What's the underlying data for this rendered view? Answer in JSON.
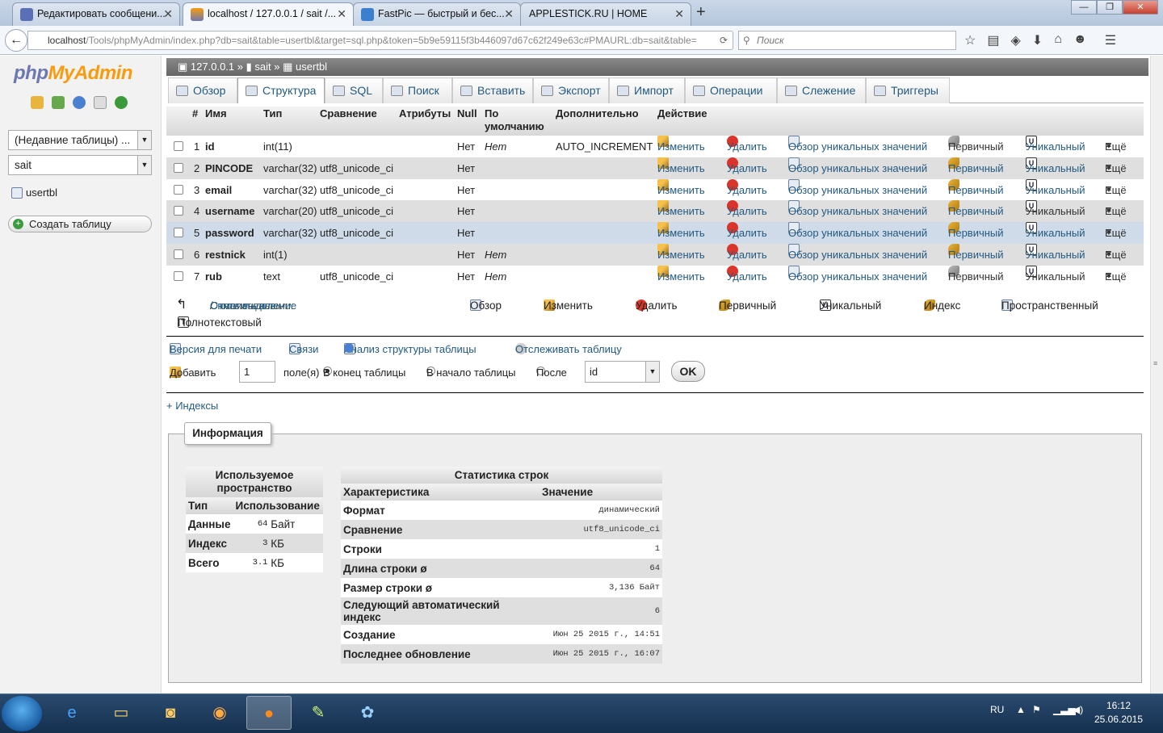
{
  "browser": {
    "tabs": [
      {
        "label": "Редактировать сообщени...",
        "favicon": "php-icon",
        "active": false
      },
      {
        "label": "localhost / 127.0.0.1 / sait /...",
        "favicon": "pma-icon",
        "active": true
      },
      {
        "label": "FastPic — быстрый и бес...",
        "favicon": "fastpic-icon",
        "active": false
      },
      {
        "label": "APPLESTICK.RU | HOME",
        "favicon": "none",
        "active": false
      }
    ],
    "url_host": "localhost",
    "url_path": "/Tools/phpMyAdmin/index.php?db=sait&table=usertbl&target=sql.php&token=5b9e59115f3b446097d67c62f249e63c#PMAURL:db=sait&table=",
    "search_placeholder": "Поиск"
  },
  "left": {
    "logo_a": "php",
    "logo_b": "MyAdmin",
    "recent": "(Недавние таблицы) ...",
    "db": "sait",
    "table": "usertbl",
    "create": "Создать таблицу"
  },
  "crumb": {
    "server": "127.0.0.1",
    "sep1": "»",
    "db": "sait",
    "sep2": "»",
    "table": "usertbl"
  },
  "tabs": [
    "Обзор",
    "Структура",
    "SQL",
    "Поиск",
    "Вставить",
    "Экспорт",
    "Импорт",
    "Операции",
    "Слежение",
    "Триггеры"
  ],
  "columns": {
    "num": "#",
    "name": "Имя",
    "type": "Тип",
    "collation": "Сравнение",
    "attributes": "Атрибуты",
    "null": "Null",
    "default": "По умолчанию",
    "extra": "Дополнительно",
    "action": "Действие"
  },
  "actions": {
    "change": "Изменить",
    "drop": "Удалить",
    "browse": "Обзор уникальных значений",
    "primary": "Первичный",
    "unique": "Уникальный",
    "more": "Ещё"
  },
  "rows": [
    {
      "n": "1",
      "name": "id",
      "type": "int(11)",
      "collation": "",
      "null": "Нет",
      "default": "Нет",
      "extra": "AUTO_INCREMENT"
    },
    {
      "n": "2",
      "name": "PINCODE",
      "type": "varchar(32)",
      "collation": "utf8_unicode_ci",
      "null": "Нет",
      "default": "",
      "extra": ""
    },
    {
      "n": "3",
      "name": "email",
      "type": "varchar(32)",
      "collation": "utf8_unicode_ci",
      "null": "Нет",
      "default": "",
      "extra": ""
    },
    {
      "n": "4",
      "name": "username",
      "type": "varchar(20)",
      "collation": "utf8_unicode_ci",
      "null": "Нет",
      "default": "",
      "extra": ""
    },
    {
      "n": "5",
      "name": "password",
      "type": "varchar(32)",
      "collation": "utf8_unicode_ci",
      "null": "Нет",
      "default": "",
      "extra": ""
    },
    {
      "n": "6",
      "name": "restnick",
      "type": "int(1)",
      "collation": "",
      "null": "Нет",
      "default": "Нет",
      "extra": ""
    },
    {
      "n": "7",
      "name": "rub",
      "type": "text",
      "collation": "utf8_unicode_ci",
      "null": "Нет",
      "default": "Нет",
      "extra": ""
    }
  ],
  "bulk": {
    "check_all": "Отметить все",
    "sep": "/",
    "uncheck": "Снять выделение",
    "with_selected": "С отмеченными:",
    "browse": "Обзор",
    "change": "Изменить",
    "drop": "Удалить",
    "primary": "Первичный",
    "unique": "Уникальный",
    "index": "Индекс",
    "spatial": "Пространственный",
    "fulltext": "Полнотекстовый"
  },
  "links": {
    "print": "Версия для печати",
    "relations": "Связи",
    "analyze": "Анализ структуры таблицы",
    "track": "Отслеживать таблицу"
  },
  "add": {
    "label": "Добавить",
    "count": "1",
    "fields": "поле(я)",
    "at_end": "В конец таблицы",
    "at_begin": "В начало таблицы",
    "after": "После",
    "after_field": "id",
    "ok": "OK"
  },
  "indexes": "+ Индексы",
  "info": {
    "legend": "Информация",
    "space": {
      "title": "Используемое пространство",
      "col_type": "Тип",
      "col_usage": "Использование",
      "rows": [
        {
          "k": "Данные",
          "v": "64",
          "u": "Байт"
        },
        {
          "k": "Индекс",
          "v": "3",
          "u": "КБ"
        },
        {
          "k": "Всего",
          "v": "3.1",
          "u": "КБ"
        }
      ]
    },
    "stats": {
      "title": "Статистика строк",
      "col_k": "Характеристика",
      "col_v": "Значение",
      "rows": [
        {
          "k": "Формат",
          "v": "динамический"
        },
        {
          "k": "Сравнение",
          "v": "utf8_unicode_ci"
        },
        {
          "k": "Строки",
          "v": "1"
        },
        {
          "k": "Длина строки ø",
          "v": "64"
        },
        {
          "k": "Размер строки ø",
          "v": "3,136 Байт"
        },
        {
          "k": "Следующий автоматический индекс",
          "v": "6"
        },
        {
          "k": "Создание",
          "v": "Июн 25 2015 г., 14:51"
        },
        {
          "k": "Последнее обновление",
          "v": "Июн 25 2015 г., 16:07"
        }
      ]
    }
  },
  "taskbar": {
    "lang": "RU",
    "time": "16:12",
    "date": "25.06.2015"
  }
}
